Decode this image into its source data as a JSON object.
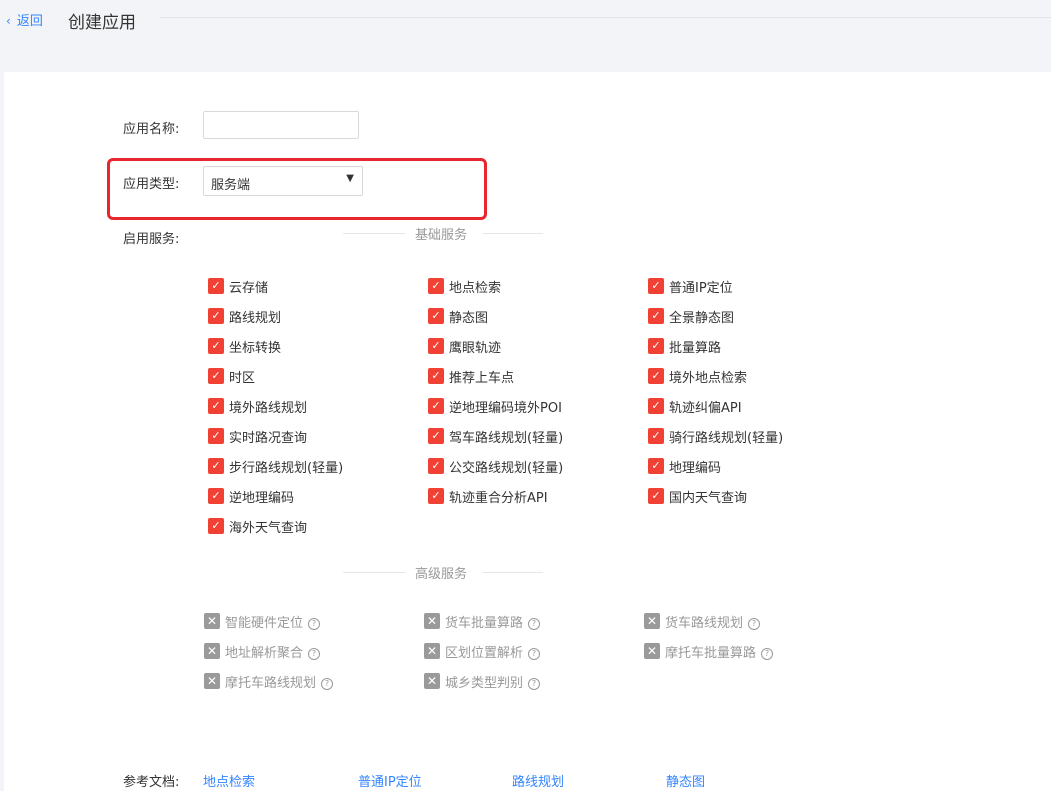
{
  "header": {
    "back_label": "返回",
    "title": "创建应用"
  },
  "form": {
    "name_label": "应用名称:",
    "name_value": "",
    "type_label": "应用类型:",
    "type_value": "服务端",
    "services_label": "启用服务:"
  },
  "basic_services": {
    "title": "基础服务",
    "items": [
      "云存储",
      "地点检索",
      "普通IP定位",
      "路线规划",
      "静态图",
      "全景静态图",
      "坐标转换",
      "鹰眼轨迹",
      "批量算路",
      "时区",
      "推荐上车点",
      "境外地点检索",
      "境外路线规划",
      "逆地理编码境外POI",
      "轨迹纠偏API",
      "实时路况查询",
      "驾车路线规划(轻量)",
      "骑行路线规划(轻量)",
      "步行路线规划(轻量)",
      "公交路线规划(轻量)",
      "地理编码",
      "逆地理编码",
      "轨迹重合分析API",
      "国内天气查询",
      "海外天气查询"
    ]
  },
  "advanced_services": {
    "title": "高级服务",
    "items": [
      "智能硬件定位",
      "货车批量算路",
      "货车路线规划",
      "地址解析聚合",
      "区划位置解析",
      "摩托车批量算路",
      "摩托车路线规划",
      "城乡类型判别"
    ]
  },
  "docs": {
    "label": "参考文档:",
    "links": [
      "地点检索",
      "普通IP定位",
      "路线规划",
      "静态图"
    ]
  },
  "colors": {
    "accent": "#3385ff",
    "checked": "#f04134",
    "disabled": "#9a9a9a",
    "highlight": "#e8262e"
  }
}
